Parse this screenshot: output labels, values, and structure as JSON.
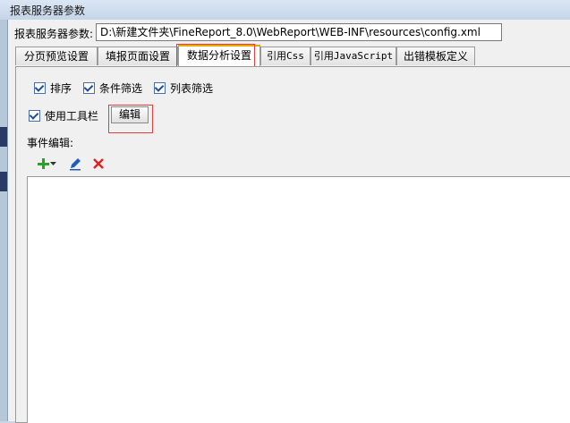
{
  "window": {
    "title": "报表服务器参数"
  },
  "path": {
    "label": "报表服务器参数:",
    "value": "D:\\新建文件夹\\FineReport_8.0\\WebReport\\WEB-INF\\resources\\config.xml"
  },
  "tabs": [
    {
      "label": "分页预览设置"
    },
    {
      "label": "填报页面设置"
    },
    {
      "label": "数据分析设置"
    },
    {
      "label": "引用Css"
    },
    {
      "label": "引用JavaScript"
    },
    {
      "label": "出错模板定义"
    }
  ],
  "active_tab_index": 2,
  "options": [
    {
      "label": "排序",
      "checked": true
    },
    {
      "label": "条件筛选",
      "checked": true
    },
    {
      "label": "列表筛选",
      "checked": true
    }
  ],
  "toolbar_option": {
    "label": "使用工具栏",
    "checked": true,
    "button_label": "编辑"
  },
  "events": {
    "label": "事件编辑:",
    "items": []
  },
  "icons": {
    "add": "add-icon",
    "dropdown": "dropdown-arrow-icon",
    "edit": "edit-pencil-icon",
    "delete": "delete-x-icon"
  },
  "colors": {
    "add": "#2aa22a",
    "edit": "#1e5fb8",
    "delete": "#e02020",
    "highlight": "#e04040",
    "active_tab_accent": "#f2a700"
  }
}
